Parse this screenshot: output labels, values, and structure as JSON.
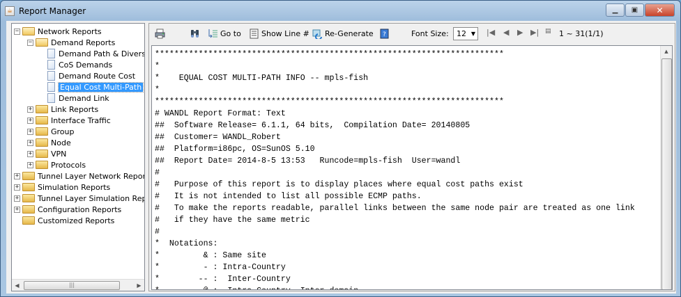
{
  "window": {
    "title": "Report Manager",
    "controls": [
      "minimize",
      "maximize",
      "close"
    ]
  },
  "tree": [
    {
      "label": "Network Reports",
      "level": 0,
      "type": "folder",
      "expanded": true
    },
    {
      "label": "Demand Reports",
      "level": 1,
      "type": "folder",
      "expanded": true
    },
    {
      "label": "Demand Path & Diversi",
      "level": 2,
      "type": "doc"
    },
    {
      "label": "CoS Demands",
      "level": 2,
      "type": "doc"
    },
    {
      "label": "Demand Route Cost",
      "level": 2,
      "type": "doc"
    },
    {
      "label": "Equal Cost Multi-Path",
      "level": 2,
      "type": "doc",
      "selected": true
    },
    {
      "label": "Demand Link",
      "level": 2,
      "type": "doc"
    },
    {
      "label": "Link Reports",
      "level": 1,
      "type": "folder",
      "expanded": false
    },
    {
      "label": "Interface Traffic",
      "level": 1,
      "type": "folder",
      "expanded": false
    },
    {
      "label": "Group",
      "level": 1,
      "type": "folder",
      "expanded": false
    },
    {
      "label": "Node",
      "level": 1,
      "type": "folder",
      "expanded": false
    },
    {
      "label": "VPN",
      "level": 1,
      "type": "folder",
      "expanded": false
    },
    {
      "label": "Protocols",
      "level": 1,
      "type": "folder",
      "expanded": false
    },
    {
      "label": "Tunnel Layer Network Reports",
      "level": 0,
      "type": "folder",
      "expanded": false
    },
    {
      "label": "Simulation Reports",
      "level": 0,
      "type": "folder",
      "expanded": false
    },
    {
      "label": "Tunnel Layer Simulation Report",
      "level": 0,
      "type": "folder",
      "expanded": false
    },
    {
      "label": "Configuration Reports",
      "level": 0,
      "type": "folder",
      "expanded": false
    },
    {
      "label": "Customized Reports",
      "level": 0,
      "type": "folder",
      "leaf": true
    }
  ],
  "toolbar": {
    "goto": "Go to",
    "show_line": "Show Line #",
    "regenerate": "Re-Generate",
    "font_size_label": "Font Size:",
    "font_size": "12",
    "range": "1 ~ 31(1/1)"
  },
  "report_lines": [
    "************************************************************************",
    "*",
    "*    EQUAL COST MULTI-PATH INFO -- mpls-fish",
    "*",
    "************************************************************************",
    "# WANDL Report Format: Text",
    "##  Software Release= 6.1.1, 64 bits,  Compilation Date= 20140805",
    "##  Customer= WANDL_Robert",
    "##  Platform=i86pc, OS=SunOS 5.10",
    "##  Report Date= 2014-8-5 13:53   Runcode=mpls-fish  User=wandl",
    "#",
    "#   Purpose of this report is to display places where equal cost paths exist",
    "#   It is not intended to list all possible ECMP paths.",
    "#   To make the reports readable, parallel links between the same node pair are treated as one link",
    "#   if they have the same metric",
    "#",
    "*  Notations:",
    "*         & : Same site",
    "*         - : Intra-Country",
    "*        -- :  Inter-Country",
    "*         @ :  Intra-Country  Inter-domain"
  ]
}
